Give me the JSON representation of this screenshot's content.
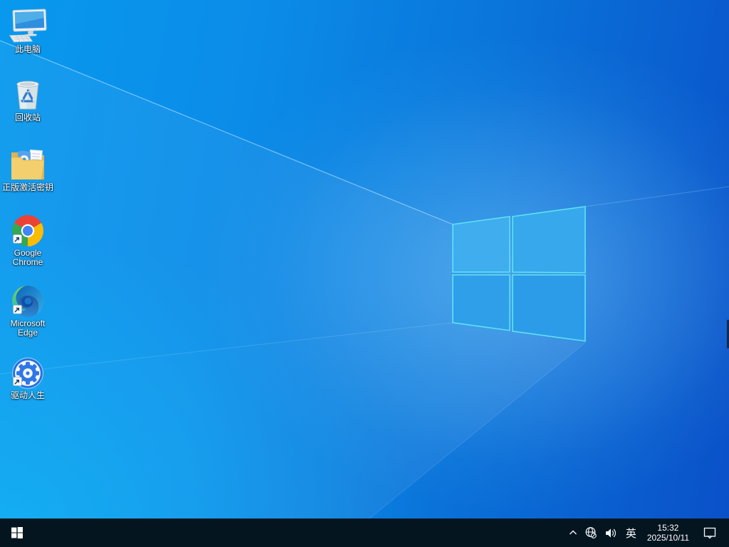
{
  "desktop": {
    "icons": [
      {
        "id": "this-pc",
        "label": "此电脑",
        "has_shortcut_arrow": false
      },
      {
        "id": "recycle-bin",
        "label": "回收站",
        "has_shortcut_arrow": false
      },
      {
        "id": "activation-key",
        "label": "正版激活密钥",
        "has_shortcut_arrow": false
      },
      {
        "id": "google-chrome",
        "label": "Google Chrome",
        "has_shortcut_arrow": true
      },
      {
        "id": "microsoft-edge",
        "label": "Microsoft Edge",
        "has_shortcut_arrow": true
      },
      {
        "id": "driver-life",
        "label": "驱动人生",
        "has_shortcut_arrow": true
      }
    ]
  },
  "taskbar": {
    "tray": {
      "ime": "英",
      "time": "15:32",
      "date": "2025/10/11"
    }
  },
  "colors": {
    "taskbar_background": "#041520",
    "wallpaper_left": "#0899ee",
    "wallpaper_right": "#0a50c8",
    "wallpaper_bottom_left": "#04adf2",
    "logo_pane_fill": "#35a7ee",
    "logo_pane_edge": "#5ee3f6",
    "tray_icon_color": "#f4f8fa"
  }
}
